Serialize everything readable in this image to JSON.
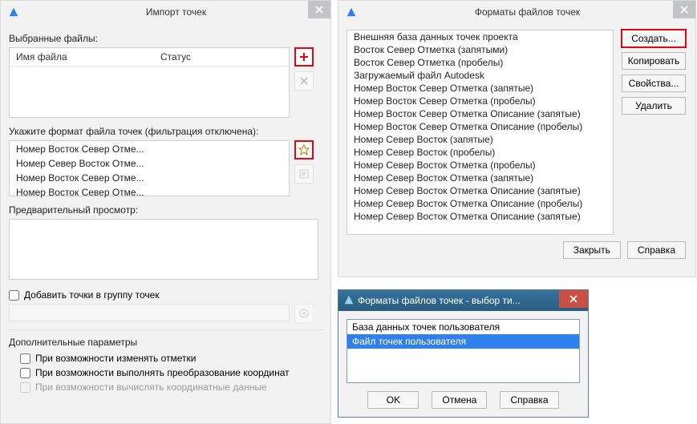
{
  "import_dialog": {
    "title": "Импорт точек",
    "selected_files": "Выбранные файлы:",
    "col_filename": "Имя файла",
    "col_status": "Статус",
    "format_label": "Укажите формат файла точек (фильтрация отключена):",
    "formats": [
      "Номер Восток Север Отме...",
      "Номер Север Восток Отме...",
      "Номер Восток Север Отме...",
      "Номер Восток Север Отме..."
    ],
    "preview_label": "Предварительный просмотр:",
    "add_to_group": "Добавить точки в группу точек",
    "advanced": "Дополнительные параметры",
    "chk_elev": "При возможности изменять отметки",
    "chk_coord": "При возможности выполнять преобразование координат",
    "chk_calc": "При возможности вычислять координатные данные"
  },
  "formats_dialog": {
    "title": "Форматы файлов точек",
    "items": [
      "Внешняя база данных точек проекта",
      "Восток Север Отметка (запятыми)",
      "Восток Север Отметка (пробелы)",
      "Загружаемый файл Autodesk",
      "Номер Восток Север Отметка (запятые)",
      "Номер Восток Север Отметка (пробелы)",
      "Номер Восток Север Отметка Описание (запятые)",
      "Номер Восток Север Отметка Описание (пробелы)",
      "Номер Север Восток (запятые)",
      "Номер Север Восток (пробелы)",
      "Номер Север Восток Отметка  (пробелы)",
      "Номер Север Восток Отметка (запятые)",
      "Номер Север Восток Отметка Описание (запятые)",
      "Номер Север Восток Отметка Описание (пробелы)",
      "Номер Север Восток Отметка Описание (запятые)"
    ],
    "create": "Создать...",
    "copy": "Копировать",
    "props": "Свойства...",
    "delete": "Удалить",
    "close": "Закрыть",
    "help": "Справка"
  },
  "type_dialog": {
    "title": "Форматы файлов точек - выбор ти...",
    "opt_db": "База данных точек пользователя",
    "opt_file": "Файл точек пользователя",
    "ok": "OK",
    "cancel": "Отмена",
    "help": "Справка"
  }
}
